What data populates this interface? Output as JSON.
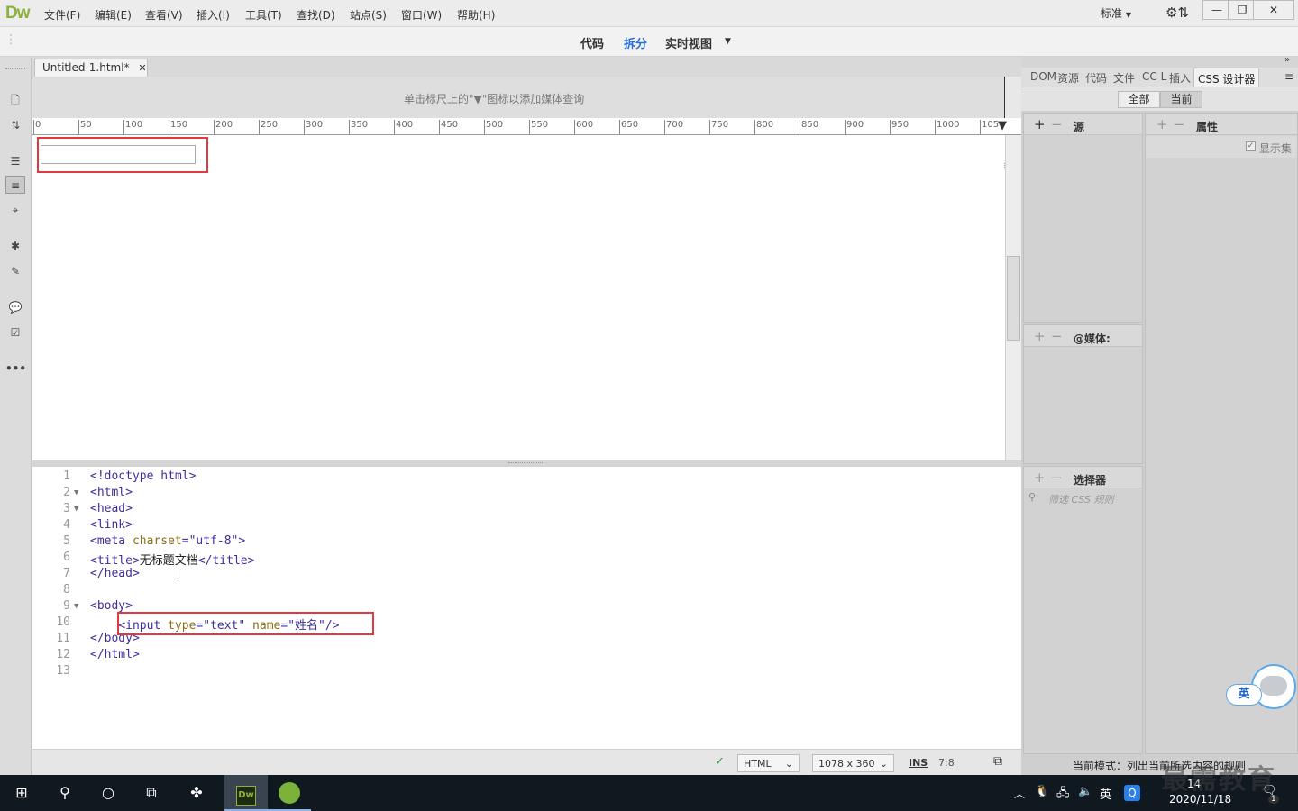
{
  "app": {
    "logo": "Dw"
  },
  "menu": [
    "文件(F)",
    "编辑(E)",
    "查看(V)",
    "插入(I)",
    "工具(T)",
    "查找(D)",
    "站点(S)",
    "窗口(W)",
    "帮助(H)"
  ],
  "workspace": {
    "label": "标准"
  },
  "window_buttons": [
    "—",
    "❐",
    "✕"
  ],
  "views": {
    "code": "代码",
    "split": "拆分",
    "live": "实时视图",
    "active": "split"
  },
  "doc_tab": {
    "label": "Untitled-1.html*"
  },
  "media_query_hint": "单击标尺上的\"▼\"图标以添加媒体查询",
  "ruler_ticks": [
    "0",
    "50",
    "100",
    "150",
    "200",
    "250",
    "300",
    "350",
    "400",
    "450",
    "500",
    "550",
    "600",
    "650",
    "700",
    "750",
    "800",
    "850",
    "900",
    "950",
    "1000",
    "105"
  ],
  "code_lines": [
    {
      "n": "1",
      "html": "<span class=\"tag\">&lt;!doctype html&gt;</span>"
    },
    {
      "n": "2",
      "fold": true,
      "html": "<span class=\"tag\">&lt;html&gt;</span>"
    },
    {
      "n": "3",
      "fold": true,
      "html": "<span class=\"tag\">&lt;head&gt;</span>"
    },
    {
      "n": "4",
      "html": "<span class=\"tag\">&lt;link&gt;</span>"
    },
    {
      "n": "5",
      "html": "<span class=\"tag\">&lt;meta </span><span class=\"attr\">charset</span><span class=\"tag\">=</span><span class=\"val\">\"utf-8\"</span><span class=\"tag\">&gt;</span>"
    },
    {
      "n": "6",
      "html": "<span class=\"tag\">&lt;title&gt;</span><span class=\"txt\">无标题文档</span><span class=\"tag\">&lt;/title&gt;</span>"
    },
    {
      "n": "7",
      "html": "<span class=\"tag\">&lt;/head&gt;</span>"
    },
    {
      "n": "8",
      "html": ""
    },
    {
      "n": "9",
      "fold": true,
      "html": "<span class=\"tag\">&lt;body&gt;</span>"
    },
    {
      "n": "10",
      "html": "    <span class=\"tag\">&lt;input </span><span class=\"attr\">type</span><span class=\"tag\">=</span><span class=\"val\">\"text\"</span> <span class=\"attr\">name</span><span class=\"tag\">=</span><span class=\"val\">\"姓名\"</span><span class=\"tag\">/&gt;</span>"
    },
    {
      "n": "11",
      "html": "<span class=\"tag\">&lt;/body&gt;</span>"
    },
    {
      "n": "12",
      "html": "<span class=\"tag\">&lt;/html&gt;</span>"
    },
    {
      "n": "13",
      "html": ""
    }
  ],
  "status": {
    "lang": "HTML",
    "size": "1078 x 360",
    "mode": "INS",
    "pos": "7:8"
  },
  "right_tabs": [
    "DOM",
    "资源",
    "代码",
    "文件",
    "CC L",
    "插入",
    "CSS 设计器"
  ],
  "css_designer": {
    "all": "全部",
    "current": "当前",
    "source": "源",
    "properties": "属性",
    "show_set": "显示集",
    "media": "@媒体:",
    "selectors": "选择器",
    "filter_placeholder": "筛选 CSS 规则",
    "mode_text": "当前模式：列出当前所选内容的规则"
  },
  "ime": "英",
  "taskbar": {
    "clock_time": "14",
    "clock_date": "2020/11/18",
    "ime": "英",
    "notif": "1"
  },
  "watermark": "最需教育"
}
